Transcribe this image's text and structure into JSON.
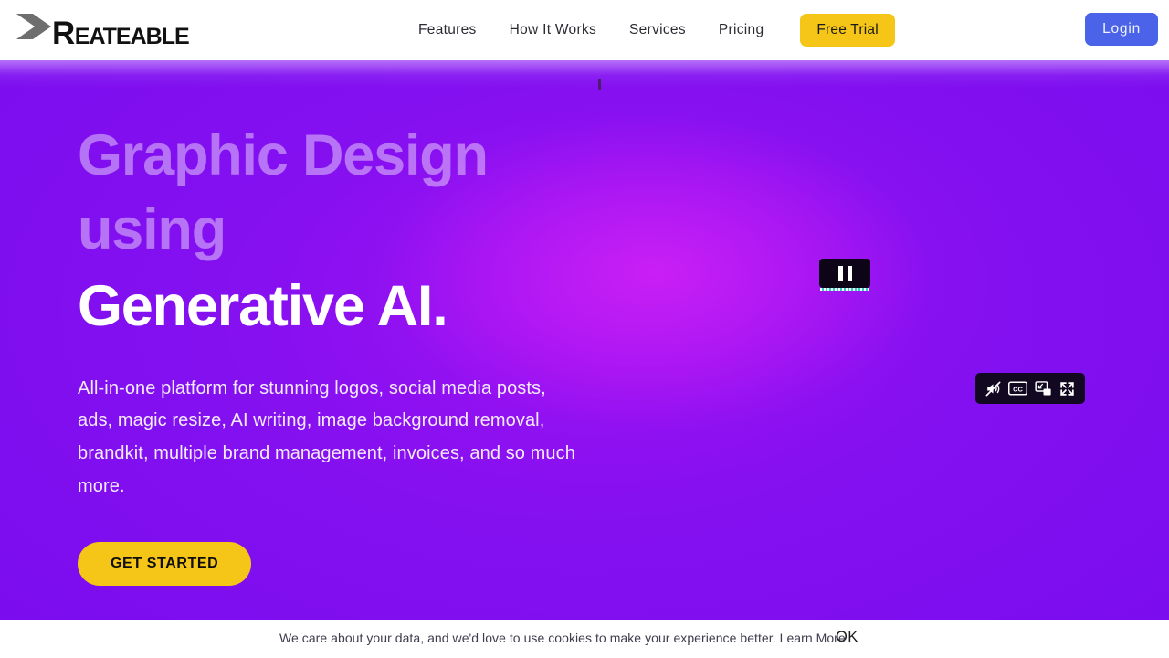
{
  "header": {
    "logo": {
      "mark_icon": "k-chevron-logo-icon",
      "cap_letter": "R",
      "rest_letters": "EATEABLE",
      "full_text": "KREATEABLE"
    },
    "nav_items": [
      {
        "label": "Features"
      },
      {
        "label": "How It Works"
      },
      {
        "label": "Services"
      },
      {
        "label": "Pricing"
      }
    ],
    "free_trial_label": "Free Trial",
    "login_label": "Login",
    "colors": {
      "accent_yellow": "#f5c518",
      "login_blue": "#4a63e8",
      "nav_text": "#2b2b33"
    }
  },
  "hero": {
    "title_muted": "Graphic Design using",
    "title_strong": "Generative AI.",
    "subtitle": "All-in-one platform for stunning logos, social media posts, ads, magic resize, AI writing, image background removal, brandkit, multiple brand management, invoices, and so much more.",
    "cta_label": "GET STARTED",
    "colors": {
      "bg_violet": "#7d0ef0",
      "bg_magenta_glow": "#c91ff5",
      "title_muted_color": "rgba(255,255,255,0.42)",
      "title_strong_color": "#ffffff"
    }
  },
  "video_controls": {
    "pause_icon": "pause-icon",
    "pause_label": "Pause",
    "bar_items": [
      {
        "icon": "mute-speaker-icon",
        "label": "Mute"
      },
      {
        "icon": "closed-captions-icon",
        "label": "CC"
      },
      {
        "icon": "picture-in-picture-icon",
        "label": "Picture in picture"
      },
      {
        "icon": "fullscreen-icon",
        "label": "Fullscreen"
      }
    ]
  },
  "cookie_banner": {
    "message": "We care about your data, and we'd love to use cookies to make your experience better.",
    "learn_more_label": "Learn More",
    "ok_label": "OK"
  }
}
